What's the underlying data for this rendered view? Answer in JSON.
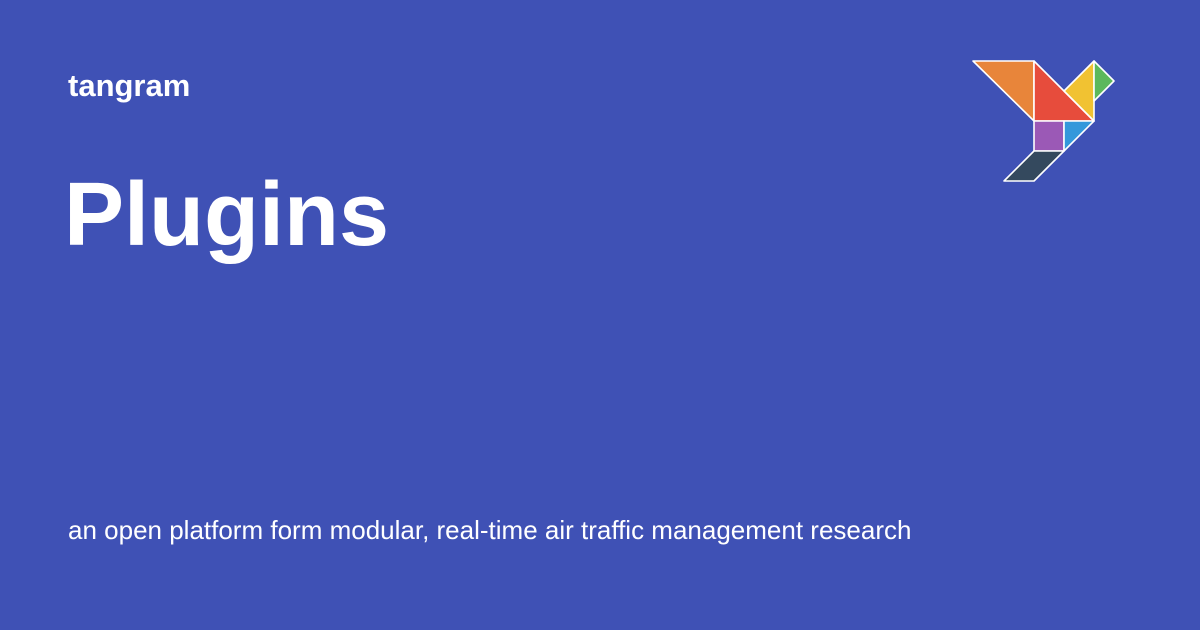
{
  "header": {
    "site_name": "tangram"
  },
  "main": {
    "title": "Plugins",
    "description": "an open platform form modular, real-time air traffic management research"
  },
  "logo": {
    "icon": "tangram-bird-icon",
    "colors": {
      "orange": "#e8853a",
      "red": "#e74c3c",
      "yellow": "#f1c232",
      "green": "#5cb85c",
      "purple": "#9b59b6",
      "blue": "#3498db",
      "navy": "#34495e",
      "background": "#3f51b5"
    }
  }
}
